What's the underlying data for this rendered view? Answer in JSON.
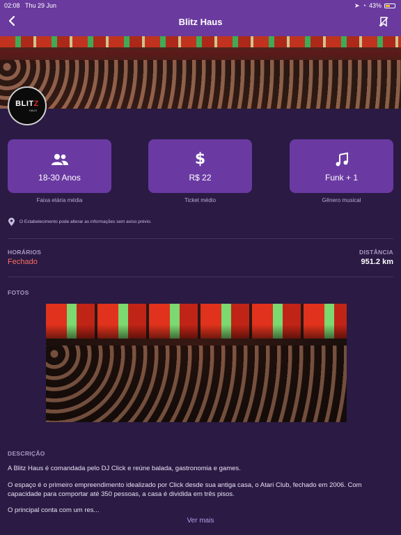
{
  "status_bar": {
    "time": "02:08",
    "date": "Thu 29 Jun",
    "battery": "43%"
  },
  "header": {
    "title": "Blitz Haus",
    "back_icon": "chevron-left-icon",
    "action_icon": "no-bookmark-icon"
  },
  "venue": {
    "logo_text": "BLITZ",
    "logo_sub": "HAUS"
  },
  "cards": [
    {
      "icon": "people-icon",
      "value": "18-30 Anos",
      "caption": "Faixa etária média"
    },
    {
      "icon": "dollar-icon",
      "value": "R$ 22",
      "caption": "Ticket médio"
    },
    {
      "icon": "music-note-icon",
      "value": "Funk + 1",
      "caption": "Gênero musical"
    }
  ],
  "notice": "O Estabelecimento pode alterar as informações sem aviso prévio.",
  "hours": {
    "label": "HORÁRIOS",
    "value": "Fechado"
  },
  "distance": {
    "label": "DISTÂNCIA",
    "value": "951.2 km"
  },
  "photos": {
    "label": "FOTOS"
  },
  "description": {
    "label": "DESCRIÇÃO",
    "paragraphs": [
      "A Blitz Haus é comandada pelo DJ Click e reúne balada, gastronomia e games.",
      "O espaço é o primeiro empreendimento idealizado por Click desde sua antiga casa, o Atari Club, fechado em 2006. Com capacidade para comportar até 350 pessoas, a casa é dividida em três pisos.",
      "O principal conta com um res..."
    ],
    "more_label": "Ver mais"
  },
  "colors": {
    "header": "#6a3a9e",
    "background": "#2a1a44",
    "card": "#6a3aa2",
    "closed": "#ff6f5e",
    "link": "#b79fe6"
  }
}
